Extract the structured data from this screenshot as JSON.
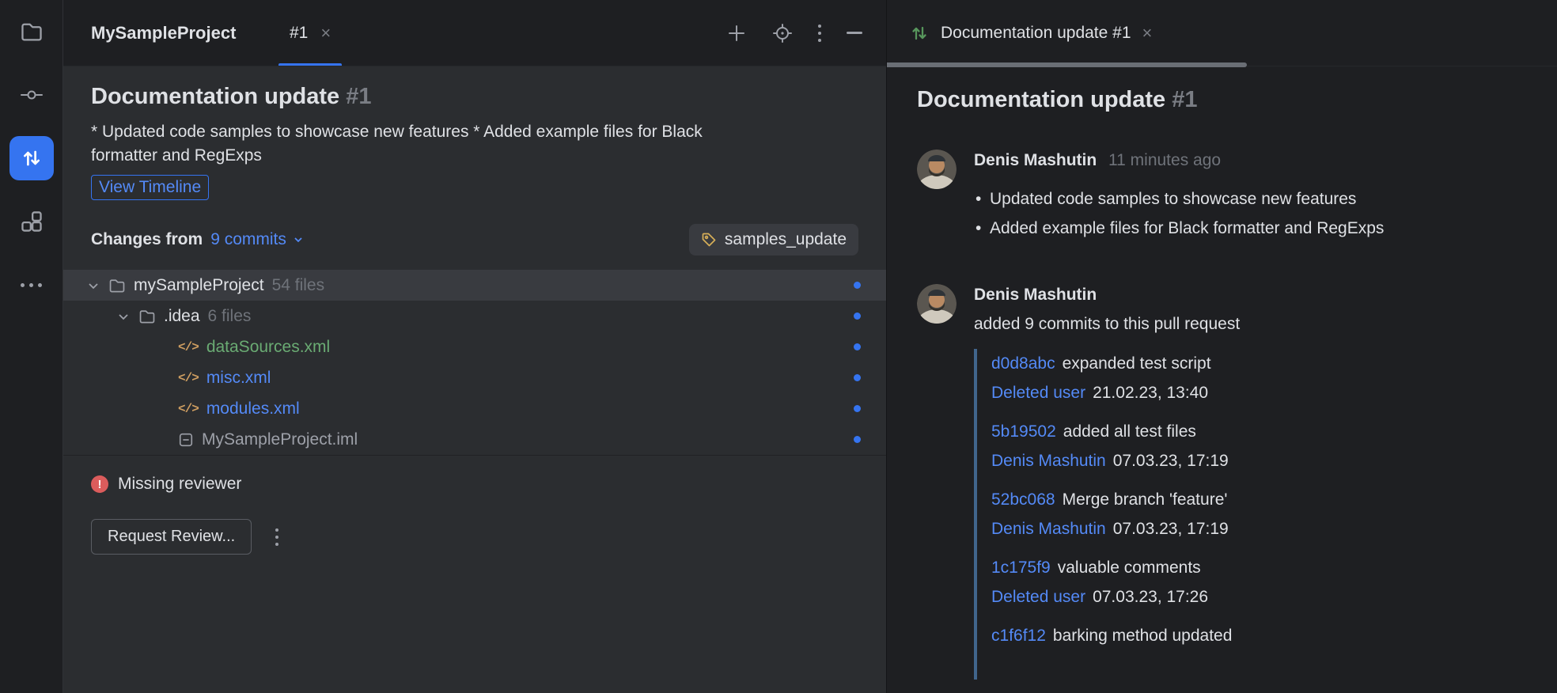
{
  "colors": {
    "accent_blue": "#3574f0",
    "link_blue": "#548af7",
    "added_green": "#6aab73",
    "tag_gold": "#d6ae58",
    "error_red": "#db5c5c",
    "window_bg": "#1e1f22",
    "panel_bg": "#2b2d30",
    "selection_bg": "#393b40"
  },
  "icons": {
    "close_glyph": "×",
    "xml_glyph": "</>",
    "error_glyph": "!",
    "left_toolbar": [
      "project-icon",
      "commit-icon",
      "pull-requests-icon",
      "structure-icon",
      "more-icon"
    ],
    "header_actions": [
      "plus-icon",
      "locate-icon",
      "menu-kebab-icon",
      "hide-icon"
    ]
  },
  "window": {
    "title": "MySampleProject",
    "tab": "#1"
  },
  "pr": {
    "title": "Documentation update",
    "number": "#1",
    "description": "* Updated code samples to showcase new features * Added example files for Black formatter and RegExps",
    "view_timeline_label": "View Timeline",
    "changes_from_label": "Changes from",
    "commits_dropdown": "9 commits",
    "branch_tag": "samples_update"
  },
  "tree": {
    "rows": [
      {
        "name": "mySampleProject",
        "meta": "54 files"
      },
      {
        "name": ".idea",
        "meta": "6 files"
      },
      {
        "name": "dataSources.xml"
      },
      {
        "name": "misc.xml"
      },
      {
        "name": "modules.xml"
      },
      {
        "name": "MySampleProject.iml"
      }
    ]
  },
  "footer": {
    "warning": "Missing reviewer",
    "request_review_label": "Request Review..."
  },
  "timeline": {
    "tab_title": "Documentation update #1",
    "title": "Documentation update",
    "number": "#1",
    "comment": {
      "author": "Denis Mashutin",
      "time": "11 minutes ago",
      "bullets": [
        "Updated code samples to showcase new features",
        "Added example files for Black formatter and RegExps"
      ]
    },
    "event": {
      "author": "Denis Mashutin",
      "action": "added 9 commits to this pull request",
      "commits": [
        {
          "hash": "d0d8abc",
          "message": "expanded test script",
          "author": "Deleted user",
          "date": "21.02.23, 13:40"
        },
        {
          "hash": "5b19502",
          "message": "added all test files",
          "author": "Denis Mashutin",
          "date": "07.03.23, 17:19"
        },
        {
          "hash": "52bc068",
          "message": "Merge branch 'feature'",
          "author": "Denis Mashutin",
          "date": "07.03.23, 17:19"
        },
        {
          "hash": "1c175f9",
          "message": "valuable comments",
          "author": "Deleted user",
          "date": "07.03.23, 17:26"
        },
        {
          "hash": "c1f6f12",
          "message": "barking method updated"
        }
      ]
    }
  }
}
